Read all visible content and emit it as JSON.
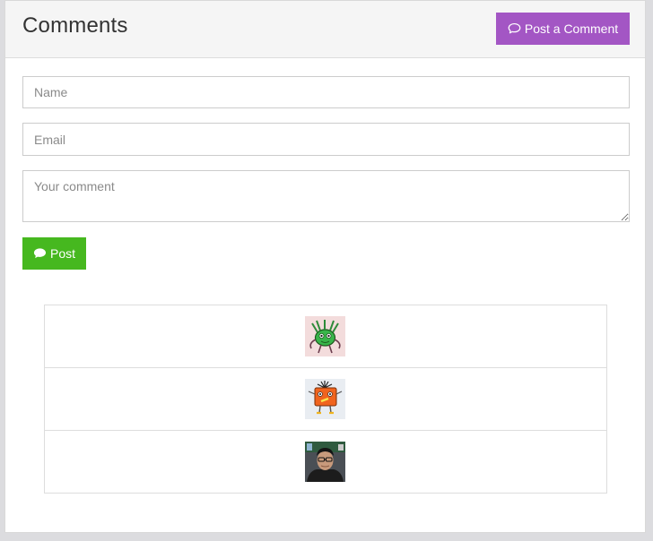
{
  "header": {
    "title": "Comments",
    "post_a_comment_label": "Post a Comment"
  },
  "form": {
    "name_placeholder": "Name",
    "email_placeholder": "Email",
    "comment_placeholder": "Your comment",
    "post_label": "Post"
  },
  "avatars": [
    {
      "name": "green-monster-avatar"
    },
    {
      "name": "orange-robot-avatar"
    },
    {
      "name": "person-photo-avatar"
    }
  ],
  "colors": {
    "post_a_comment_button": "#a356c4",
    "post_button": "#46b81f"
  },
  "icons": {
    "comment_outline": "comment-outline-icon",
    "comment_solid": "comment-solid-icon"
  }
}
